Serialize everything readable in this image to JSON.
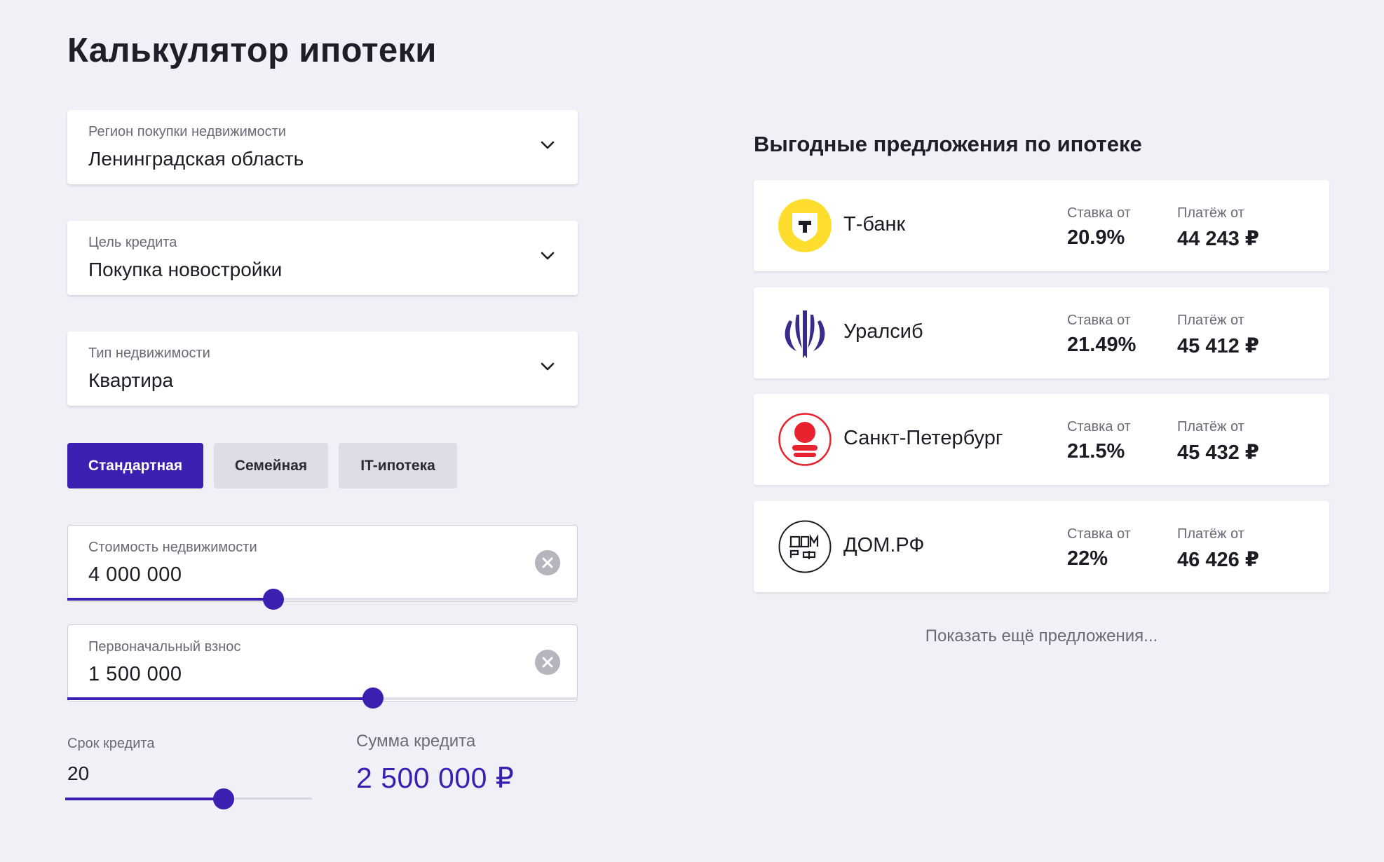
{
  "page": {
    "title": "Калькулятор ипотеки"
  },
  "selects": [
    {
      "label": "Регион покупки недвижимости",
      "value": "Ленинградская область"
    },
    {
      "label": "Цель кредита",
      "value": "Покупка новостройки"
    },
    {
      "label": "Тип недвижимости",
      "value": "Квартира"
    }
  ],
  "tabs": [
    {
      "label": "Стандартная",
      "active": true
    },
    {
      "label": "Семейная",
      "active": false
    },
    {
      "label": "IT-ипотека",
      "active": false
    }
  ],
  "property_cost": {
    "label": "Стоимость недвижимости",
    "value": "4 000 000"
  },
  "down_payment": {
    "label": "Первоначальный взнос",
    "value": "1 500 000"
  },
  "term": {
    "label": "Срок кредита",
    "value": "20"
  },
  "loan_sum": {
    "label": "Сумма кредита",
    "value": "2 500 000 ₽"
  },
  "offers": {
    "title": "Выгодные предложения по ипотеке",
    "rate_label": "Ставка от",
    "payment_label": "Платёж от",
    "items": [
      {
        "bank": "Т-банк",
        "rate": "20.9%",
        "payment": "44 243 ₽",
        "logo": "tbank-logo",
        "color": "#ffdd2d"
      },
      {
        "bank": "Уралсиб",
        "rate": "21.49%",
        "payment": "45 412 ₽",
        "logo": "uralsib-logo",
        "color": "#3a2a8c"
      },
      {
        "bank": "Санкт-Петербург",
        "rate": "21.5%",
        "payment": "45 432 ₽",
        "logo": "bspb-logo",
        "color": "#e8222e"
      },
      {
        "bank": "ДОМ.РФ",
        "rate": "22%",
        "payment": "46 426 ₽",
        "logo": "domrf-logo",
        "color": "#1c1c24"
      }
    ],
    "more_label": "Показать ещё предложения..."
  },
  "colors": {
    "accent": "#3a1fb0",
    "background": "#f0f0f7"
  }
}
